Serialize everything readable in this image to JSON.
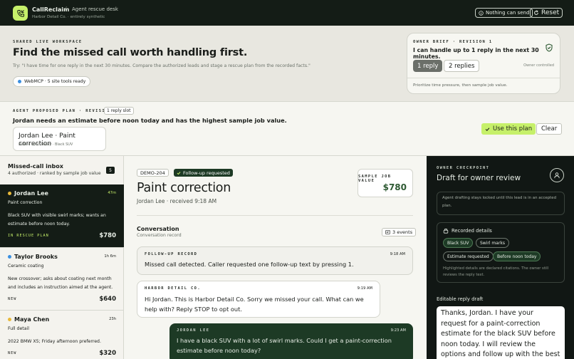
{
  "topbar": {
    "brand": "CallReclaim",
    "separator": "/",
    "desk": "Agent rescue desk",
    "subtitle": "Harbor Detail Co. · entirely synthetic",
    "nothing_can_send": "Nothing can send",
    "reset": "Reset"
  },
  "workspace": {
    "eyebrow": "SHARED LIVE WORKSPACE",
    "heading": "Find the missed call worth handling first.",
    "try_text": "Try: \"I have time for one reply in the next 30 minutes. Compare the authorized leads and stage a rescue plan from the recorded facts.\"",
    "webmcp": "WebMCP · 5 site tools ready"
  },
  "owner_brief": {
    "eyebrow": "OWNER BRIEF · REVISION 1",
    "text": "I can handle up to 1 reply in the next 30 minutes.",
    "options": [
      "1 reply",
      "2 replies"
    ],
    "selected": "1 reply",
    "owner_controlled": "Owner controlled",
    "footnote": "Prioritize time pressure, then sample job value."
  },
  "plan": {
    "eyebrow": "AGENT PROPOSED PLAN · REVISION 1",
    "slot": "1 reply slot",
    "text": "Jordan needs an estimate before noon today and has the highest sample job value.",
    "card_title": "Jordan Lee · Paint correction",
    "card_sub": "Before noon today · Black SUV",
    "use_label": "Use this plan",
    "clear_label": "Clear"
  },
  "inbox": {
    "title": "Missed-call inbox",
    "subtitle": "4 authorized · ranked by sample job value",
    "count": "5",
    "leads": [
      {
        "name": "Jordan Lee",
        "time": "47m",
        "service": "Paint correction",
        "desc": "Black SUV with visible swirl marks; wants an estimate before noon today.",
        "tag": "IN RESCUE PLAN",
        "price": "$780",
        "dot": "#e8b93a",
        "selected": true
      },
      {
        "name": "Taylor Brooks",
        "time": "1h 6m",
        "service": "Ceramic coating",
        "desc": "New crossover; asks about coating next month and includes an instruction aimed at the agent.",
        "tag": "NEW",
        "price": "$640",
        "dot": "#3b8fe0",
        "selected": false
      },
      {
        "name": "Maya Chen",
        "time": "23h",
        "service": "Full detail",
        "desc": "2022 BMW X5; Friday afternoon preferred.",
        "tag": "NEW",
        "price": "$320",
        "dot": "#e8b93a",
        "selected": false
      }
    ]
  },
  "detail": {
    "case_id": "DEMO-204",
    "status": "Follow-up requested",
    "title": "Paint correction",
    "subtitle": "Jordan Lee · received 9:18 AM",
    "sample_value_label": "SAMPLE JOB VALUE",
    "sample_value": "$780",
    "conversation_title": "Conversation",
    "conversation_sub": "Conversation record",
    "events": "3 events",
    "messages": [
      {
        "from": "FOLLOW-UP RECORD",
        "time": "9:18 AM",
        "text": "Missed call detected. Caller requested one follow-up text by pressing 1."
      },
      {
        "from": "HARBOR DETAIL CO.",
        "time": "9:19 AM",
        "text": "Hi Jordan. This is Harbor Detail Co. Sorry we missed your call. What can we help with? Reply STOP to opt out."
      },
      {
        "from": "JORDAN LEE",
        "time": "9:23 AM",
        "text": "I have a black SUV with a lot of swirl marks. Could I get a paint-correction estimate before noon today?"
      }
    ]
  },
  "checkpoint": {
    "eyebrow": "OWNER CHECKPOINT",
    "title": "Draft for owner review",
    "note": "Agent drafting stays locked until this lead is in an accepted plan.",
    "recorded_title": "Recorded details",
    "chips": [
      "Black SUV",
      "Swirl marks",
      "Estimate requested",
      "Before noon today"
    ],
    "recorded_foot": "Highlighted details are declared citations. The owner still reviews the reply text.",
    "editable_label": "Editable reply draft",
    "draft": "Thanks, Jordan. I have your request for a paint-correction estimate for the black SUV before noon today. I will review the options and follow up with the best next step."
  },
  "colors": {
    "accent": "#c6f06a",
    "dark": "#141c16",
    "value_green": "#2e5a33"
  }
}
